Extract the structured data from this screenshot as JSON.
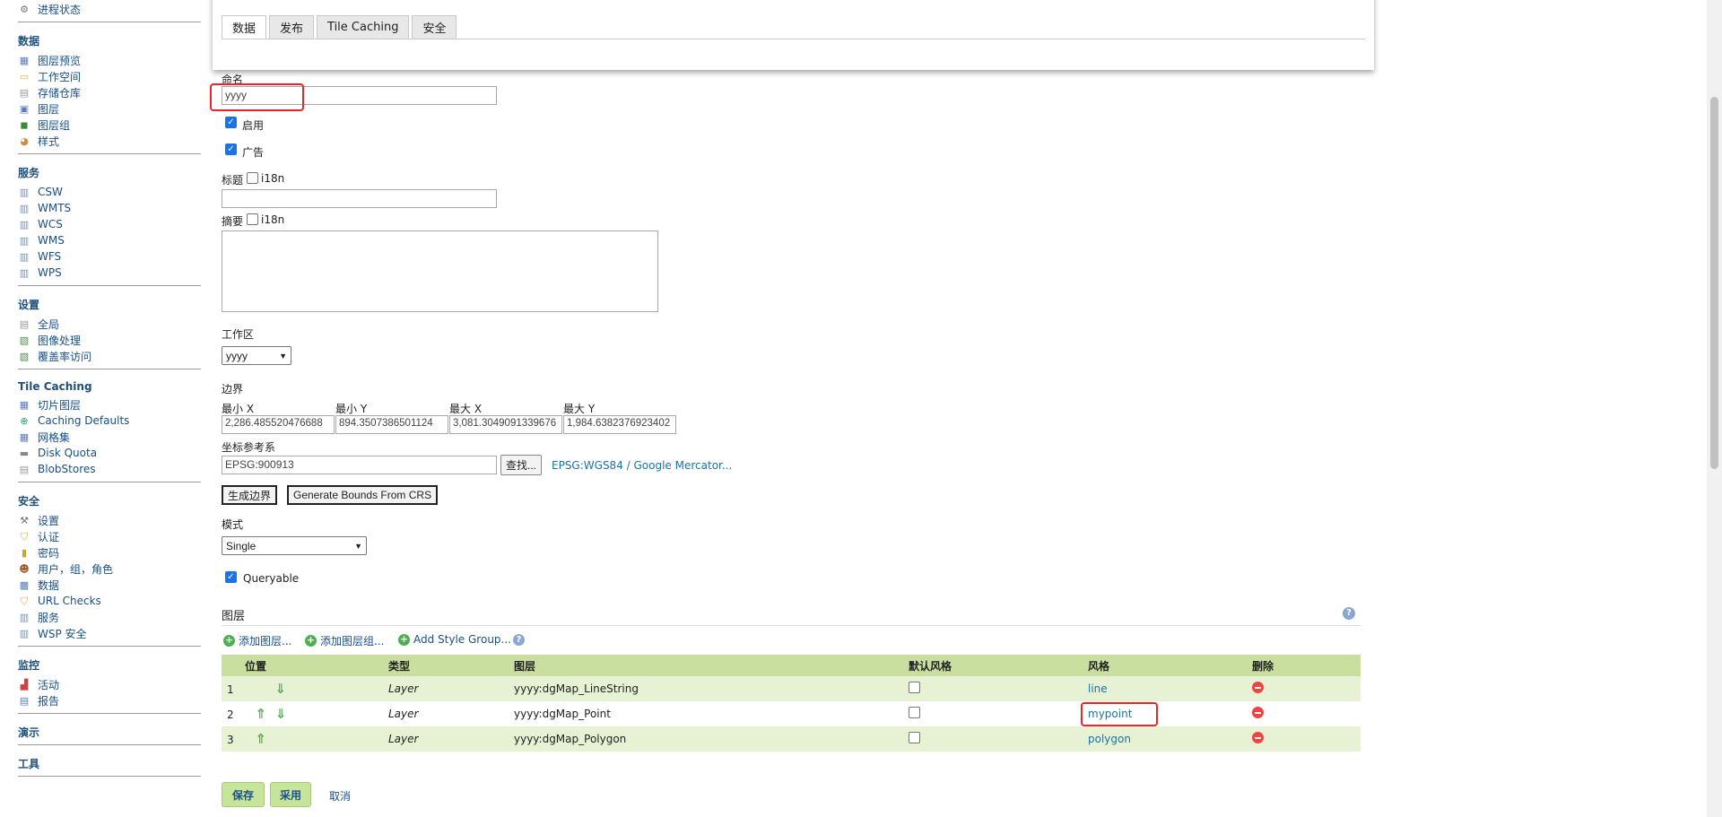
{
  "sidebar": {
    "top_item": {
      "label": "进程状态",
      "icon": "gear-icon"
    },
    "sections": [
      {
        "title": "数据",
        "items": [
          {
            "label": "图层预览",
            "icon": "layer-preview-icon"
          },
          {
            "label": "工作空间",
            "icon": "folder-icon"
          },
          {
            "label": "存储仓库",
            "icon": "database-icon"
          },
          {
            "label": "图层",
            "icon": "layer-icon"
          },
          {
            "label": "图层组",
            "icon": "layer-group-icon"
          },
          {
            "label": "样式",
            "icon": "palette-icon"
          }
        ]
      },
      {
        "title": "服务",
        "items": [
          {
            "label": "CSW",
            "icon": "service-icon"
          },
          {
            "label": "WMTS",
            "icon": "service-icon"
          },
          {
            "label": "WCS",
            "icon": "service-icon"
          },
          {
            "label": "WMS",
            "icon": "service-icon"
          },
          {
            "label": "WFS",
            "icon": "service-icon"
          },
          {
            "label": "WPS",
            "icon": "service-icon"
          }
        ]
      },
      {
        "title": "设置",
        "items": [
          {
            "label": "全局",
            "icon": "server-icon"
          },
          {
            "label": "图像处理",
            "icon": "image-icon"
          },
          {
            "label": "覆盖率访问",
            "icon": "image-icon"
          }
        ]
      },
      {
        "title": "Tile Caching",
        "items": [
          {
            "label": "切片图层",
            "icon": "grid-icon"
          },
          {
            "label": "Caching Defaults",
            "icon": "globe-icon"
          },
          {
            "label": "网格集",
            "icon": "grid-icon"
          },
          {
            "label": "Disk Quota",
            "icon": "disk-icon"
          },
          {
            "label": "BlobStores",
            "icon": "database-icon"
          }
        ]
      },
      {
        "title": "安全",
        "items": [
          {
            "label": "设置",
            "icon": "wrench-icon"
          },
          {
            "label": "认证",
            "icon": "shield-icon"
          },
          {
            "label": "密码",
            "icon": "lock-icon"
          },
          {
            "label": "用户，组，角色",
            "icon": "users-icon"
          },
          {
            "label": "数据",
            "icon": "data-security-icon"
          },
          {
            "label": "URL Checks",
            "icon": "shield-icon"
          },
          {
            "label": "服务",
            "icon": "service-icon"
          },
          {
            "label": "WSP 安全",
            "icon": "service-icon"
          }
        ]
      },
      {
        "title": "监控",
        "items": [
          {
            "label": "活动",
            "icon": "bar-chart-icon"
          },
          {
            "label": "报告",
            "icon": "report-icon"
          }
        ]
      },
      {
        "title": "演示",
        "items": []
      },
      {
        "title": "工具",
        "items": []
      }
    ]
  },
  "tabs": [
    {
      "label": "数据",
      "active": true
    },
    {
      "label": "发布",
      "active": false
    },
    {
      "label": "Tile Caching",
      "active": false
    },
    {
      "label": "安全",
      "active": false
    }
  ],
  "form": {
    "name_label": "命名",
    "name_value": "yyyy",
    "enabled_label": "启用",
    "enabled": true,
    "advertised_label": "广告",
    "advertised": true,
    "title_label": "标题",
    "i18n_label": "i18n",
    "title_value": "",
    "abstract_label": "摘要",
    "abstract_value": "",
    "workspace_label": "工作区",
    "workspace_value": "yyyy",
    "bounds_label": "边界",
    "minx_label": "最小 X",
    "miny_label": "最小 Y",
    "maxx_label": "最大 X",
    "maxy_label": "最大 Y",
    "minx": "2,286.485520476688",
    "miny": "894.3507386501124",
    "maxx": "3,081.3049091339676",
    "maxy": "1,984.6382376923402",
    "crs_label": "坐标参考系",
    "crs_value": "EPSG:900913",
    "find_button": "查找...",
    "crs_link": "EPSG:WGS84 / Google Mercator...",
    "generate_bounds_button": "生成边界",
    "generate_from_crs_button": "Generate Bounds From CRS",
    "mode_label": "模式",
    "mode_value": "Single",
    "queryable_label": "Queryable",
    "queryable": true
  },
  "layers": {
    "title": "图层",
    "add_layer": "添加图层...",
    "add_layer_group": "添加图层组...",
    "add_style_group": "Add Style Group...",
    "columns": [
      "位置",
      "类型",
      "图层",
      "默认风格",
      "风格",
      "删除"
    ],
    "rows": [
      {
        "pos": "1",
        "type": "Layer",
        "layer": "yyyy:dgMap_LineString",
        "style": "line"
      },
      {
        "pos": "2",
        "type": "Layer",
        "layer": "yyyy:dgMap_Point",
        "style": "mypoint"
      },
      {
        "pos": "3",
        "type": "Layer",
        "layer": "yyyy:dgMap_Polygon",
        "style": "polygon"
      }
    ]
  },
  "actions": {
    "save": "保存",
    "apply": "采用",
    "cancel": "取消"
  }
}
